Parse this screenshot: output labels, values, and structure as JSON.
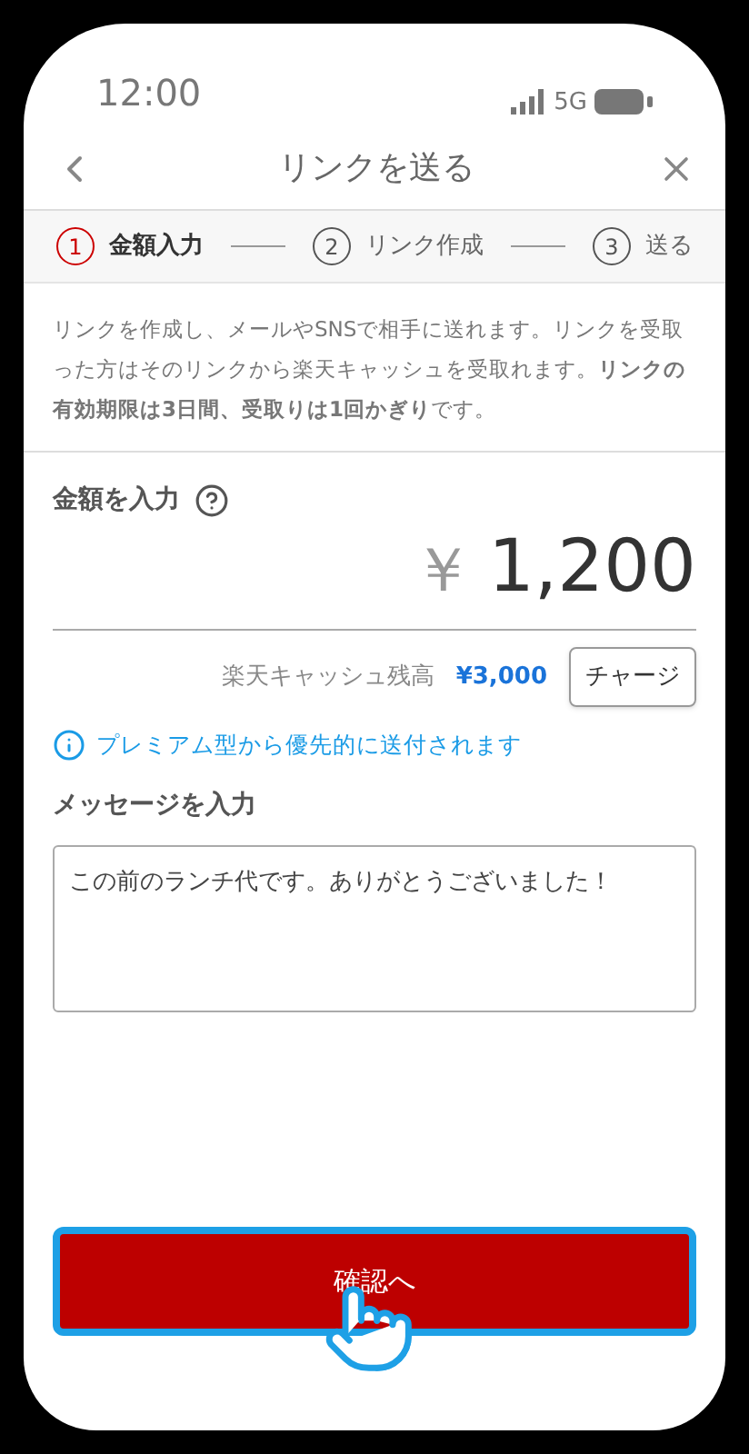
{
  "status_bar": {
    "time": "12:00",
    "network": "5G"
  },
  "header": {
    "title": "リンクを送る"
  },
  "steps": [
    {
      "number": "1",
      "label": "金額入力",
      "selected": true
    },
    {
      "number": "2",
      "label": "リンク作成",
      "selected": false
    },
    {
      "number": "3",
      "label": "送る",
      "selected": false
    }
  ],
  "description": "リンクを作成し、メールやSNSで相手に送れます。リンクを受取った方はそのリンクから楽天キャッシュを受取れます。**リンクの有効期限は3日間、受取りは1回かぎり**です。",
  "amount": {
    "label": "金額を入力",
    "currency": "￥",
    "value": "1,200"
  },
  "balance": {
    "label": "楽天キャッシュ残高",
    "value": "¥3,000",
    "button": "チャージ"
  },
  "info": "プレミアム型から優先的に送付されます",
  "message": {
    "label": "メッセージを入力",
    "value": "この前のランチ代です。ありがとうございました！"
  },
  "confirm_button": {
    "label": "確認へ"
  }
}
